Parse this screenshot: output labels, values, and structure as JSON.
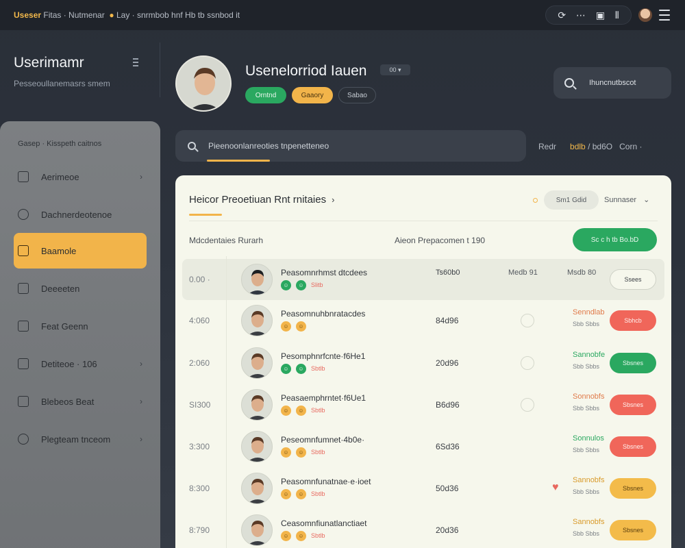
{
  "topbar": {
    "title_accent": "Useser",
    "title_text": "Fitas · Nutmenar",
    "crumb_emoji": "●",
    "crumb_text": "Lay · snrmbob hnf Hb tb ssnbod it",
    "tools": [
      "refresh-icon",
      "more-icon",
      "panel-icon",
      "split-icon"
    ]
  },
  "app": {
    "name": "Userimamr",
    "subtitle": "Pesseoullanemasrs smem"
  },
  "sidebar": {
    "header": "Gasep · Kisspeth caitnos",
    "items": [
      {
        "label": "Aerimeoe",
        "icon": "database-icon",
        "chevron": "›"
      },
      {
        "label": "Dachnerdeotenoe",
        "icon": "users-icon",
        "chevron": ""
      },
      {
        "label": "Baamole",
        "icon": "code-icon",
        "chevron": ""
      },
      {
        "label": "Deeeeten",
        "icon": "briefcase-icon",
        "chevron": ""
      },
      {
        "label": "Feat Geenn",
        "icon": "grid-icon",
        "chevron": ""
      },
      {
        "label": "Detiteoe · 106",
        "icon": "card-icon",
        "chevron": "›"
      },
      {
        "label": "Blebeos Beat",
        "icon": "building-icon",
        "chevron": "›"
      },
      {
        "label": "Plegteam tnceom",
        "icon": "info-icon",
        "chevron": "›"
      }
    ]
  },
  "profile": {
    "name": "Usenelorriod Iauen",
    "badge": "00 ▾",
    "tags": [
      {
        "label": "Orntnd"
      },
      {
        "label": "Gaaory"
      },
      {
        "label": "Sabao"
      }
    ]
  },
  "search_right": {
    "placeholder": "Ihuncnutbscot"
  },
  "search_main": {
    "placeholder": "Pieenoonlanreoties tnpenetteneo"
  },
  "filter": {
    "left": "Redr",
    "accent": "bdlb",
    "mid": "/ bd6O",
    "right": "Corn ·"
  },
  "card": {
    "title": "Heicor Preoetiuan Rnt rnitaies",
    "filter_button": "Sm1 Gdid",
    "sort_label": "Sunnaser",
    "sub_left": "Mdcdentaies Rurarh",
    "sub_mid": "Aieon   Prepacomen t 190",
    "primary_button": "Sc c h tb Bo.bD"
  },
  "rows": [
    {
      "idx": "0.00 ·",
      "name": "Peasomnrhmst dtcdees",
      "emoji": [
        "g",
        "g"
      ],
      "tag": "Slitb",
      "num": "Ts60b0",
      "col2": "Medb 91",
      "col3": "Msdb 80",
      "action": "Ssees",
      "action_style": "outline",
      "status": "",
      "status2": "",
      "heart": false,
      "circle": false,
      "highlight": true
    },
    {
      "idx": "4:060",
      "name": "Peasomnuhbnratacdes",
      "emoji": [
        "y",
        "y"
      ],
      "tag": "",
      "num": "84d96",
      "col2": "",
      "col3": "",
      "action": "Sbhcb",
      "action_style": "red",
      "status": "Senndlab",
      "status2": "Sbb Sbbs",
      "status_color": "red",
      "heart": false,
      "circle": true,
      "highlight": false
    },
    {
      "idx": "2:060",
      "name": "Pesomphnrfcnte·f6He1",
      "emoji": [
        "g",
        "g"
      ],
      "tag": "Sbtlb",
      "num": "20d96",
      "col2": "",
      "col3": "",
      "action": "Sbsnes",
      "action_style": "green",
      "status": "Sannobfe",
      "status2": "Sbb Sbbs",
      "status_color": "green",
      "heart": false,
      "circle": true,
      "highlight": false
    },
    {
      "idx": "SI300",
      "name": "Peasaemphrntet·f6Ue1",
      "emoji": [
        "y",
        "y"
      ],
      "tag": "Sbtlb",
      "num": "B6d96",
      "col2": "",
      "col3": "",
      "action": "Sbsnes",
      "action_style": "red",
      "status": "Sonnobfs",
      "status2": "Sbb Sbbs",
      "status_color": "red",
      "heart": false,
      "circle": true,
      "highlight": false
    },
    {
      "idx": "3:300",
      "name": "Peseomnfumnet·4b0e·",
      "emoji": [
        "y",
        "y"
      ],
      "tag": "Sbtlb",
      "num": "6Sd36",
      "col2": "",
      "col3": "",
      "action": "Sbsnes",
      "action_style": "red",
      "status": "Sonnulos",
      "status2": "Sbb Sbbs",
      "status_color": "green",
      "heart": false,
      "circle": false,
      "highlight": false
    },
    {
      "idx": "8:300",
      "name": "Peasomnfunatnae·e·ioet",
      "emoji": [
        "y",
        "y"
      ],
      "tag": "Sbtlb",
      "num": "50d36",
      "col2": "",
      "col3": "",
      "action": "Sbsnes",
      "action_style": "yellow",
      "status": "Sannobfs",
      "status2": "Sbb Sbbs",
      "status_color": "yellow",
      "heart": true,
      "circle": false,
      "highlight": false
    },
    {
      "idx": "8:790",
      "name": "Ceasomnfiunatlanctiaet",
      "emoji": [
        "y",
        "y"
      ],
      "tag": "Sbtlb",
      "num": "20d36",
      "col2": "",
      "col3": "",
      "action": "Sbsnes",
      "action_style": "yellow",
      "status": "Sannobfs",
      "status2": "Sbb Sbbs",
      "status_color": "yellow",
      "heart": false,
      "circle": false,
      "highlight": false
    }
  ]
}
